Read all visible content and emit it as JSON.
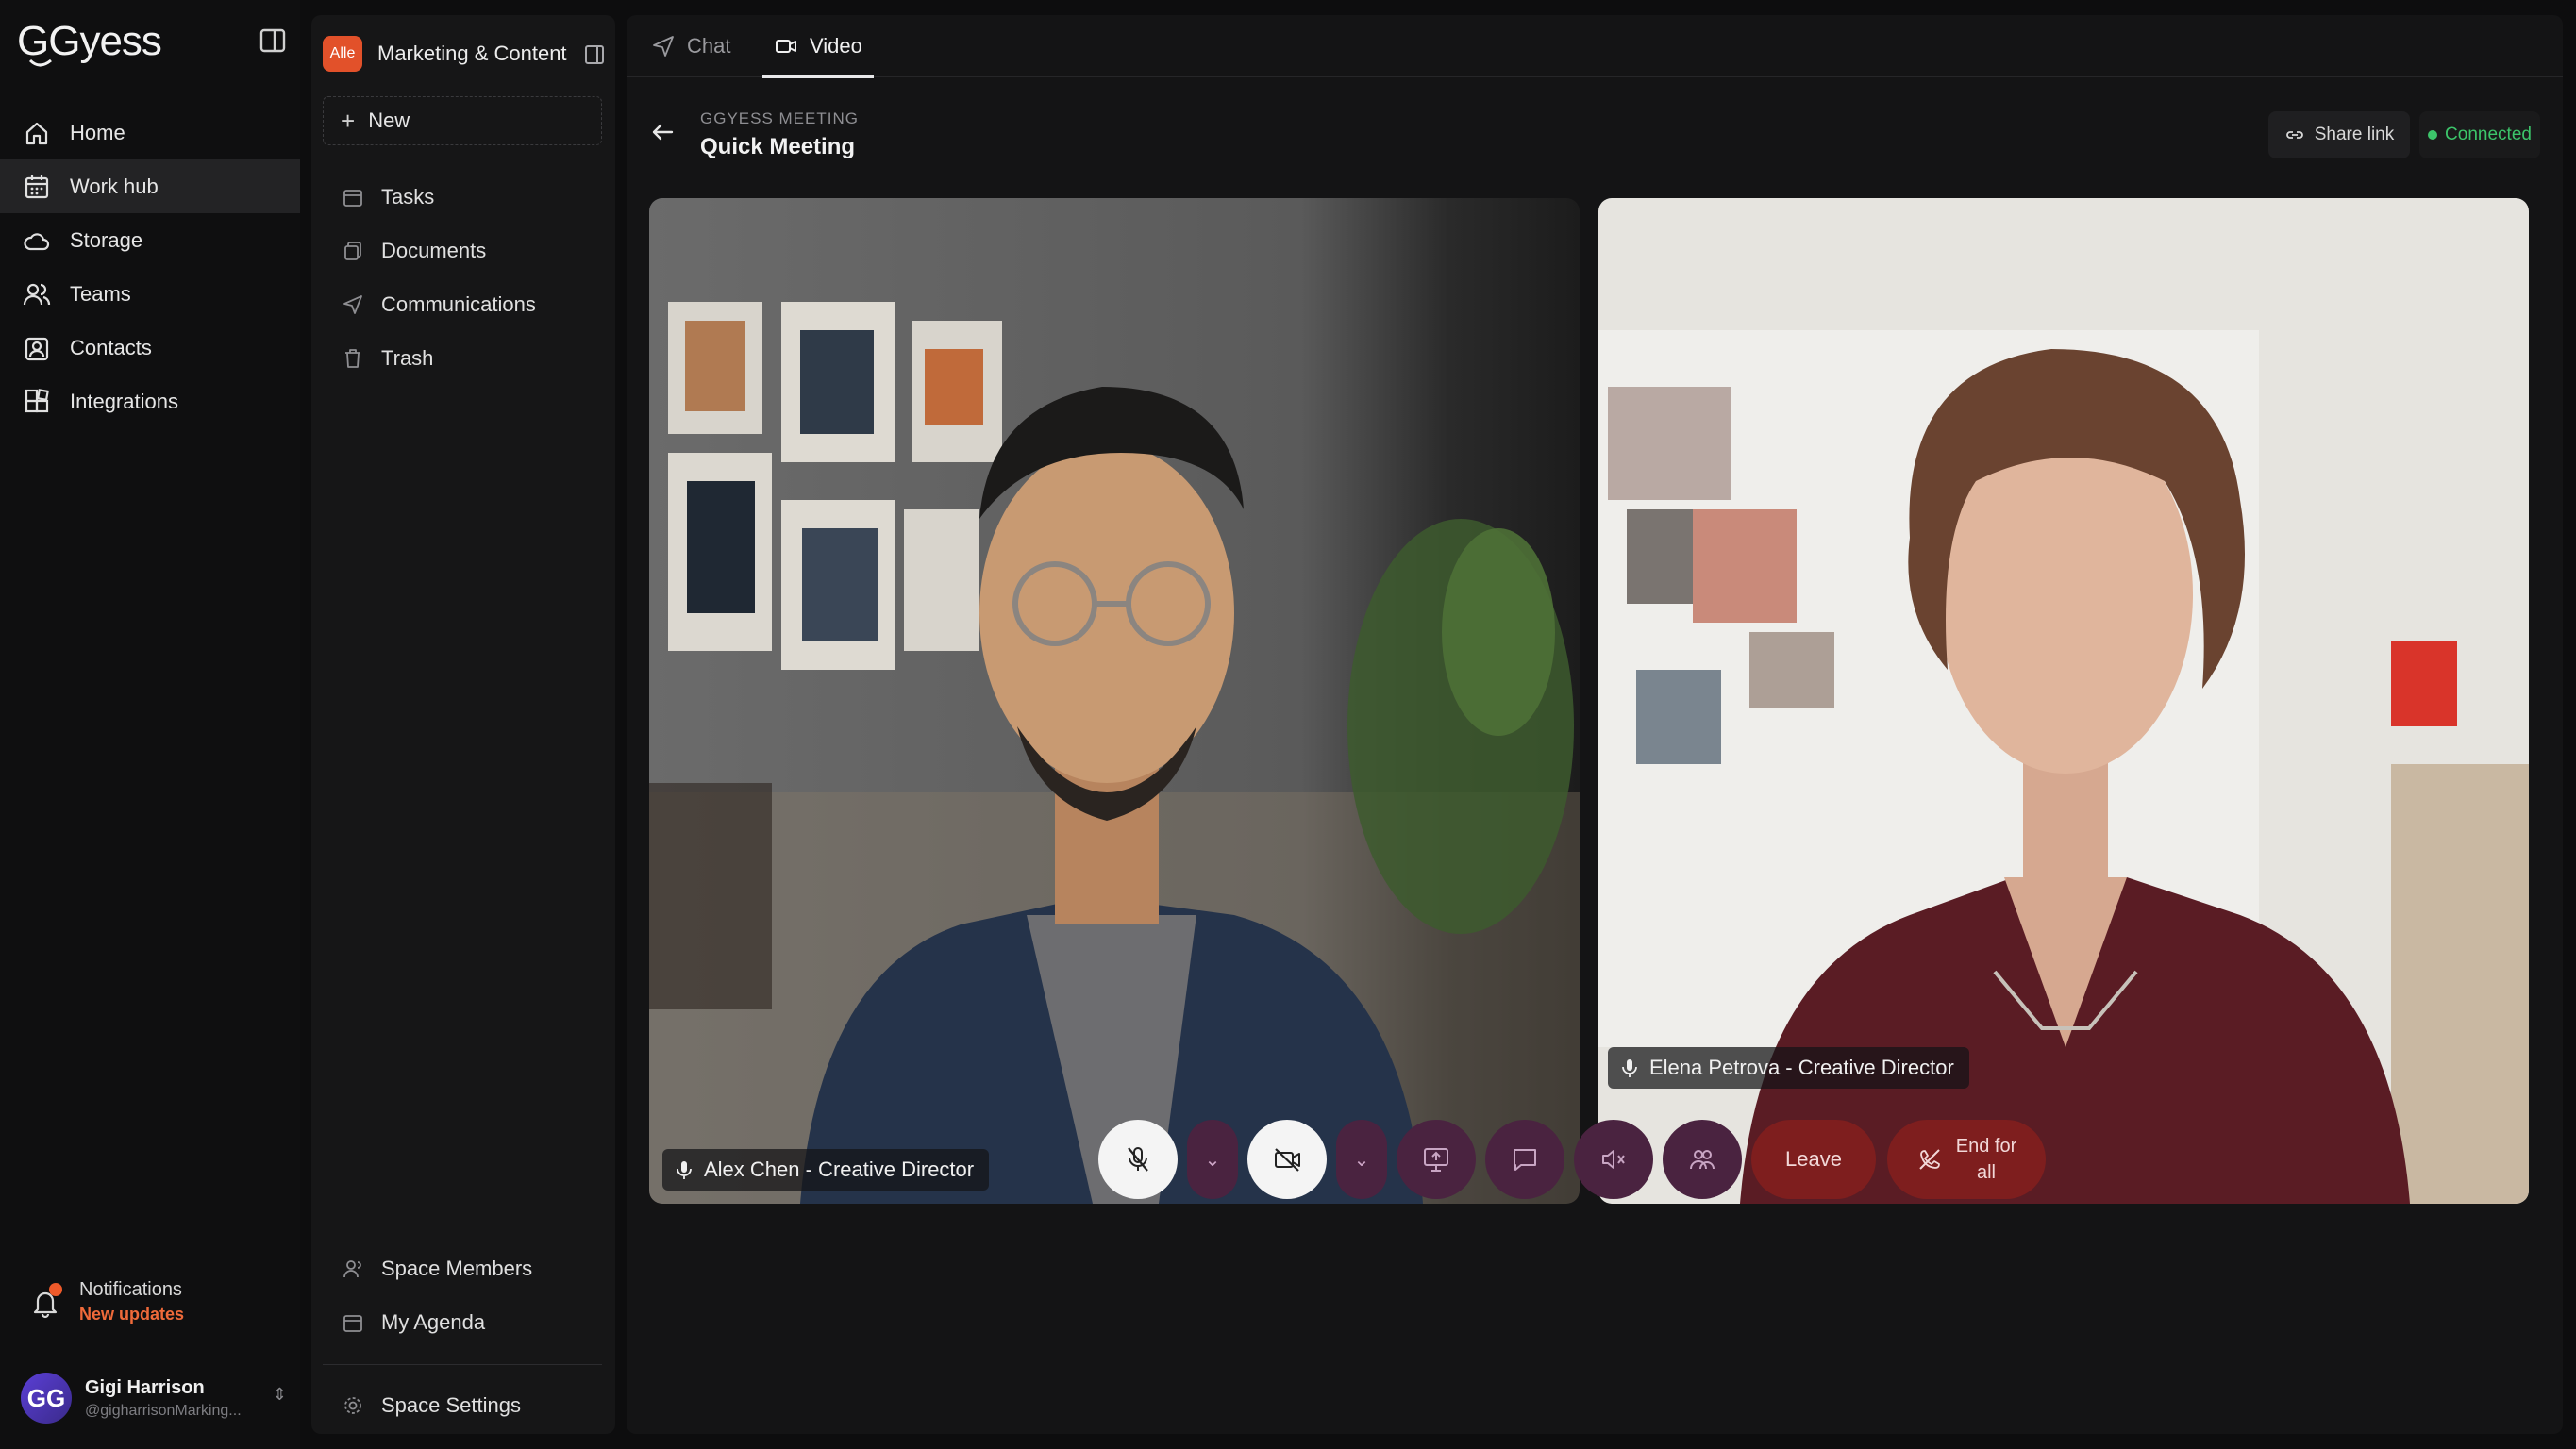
{
  "brand": {
    "logo": "GGyess"
  },
  "nav": {
    "items": [
      {
        "label": "Home",
        "icon": "home-icon"
      },
      {
        "label": "Work hub",
        "icon": "calendar-icon",
        "active": true
      },
      {
        "label": "Storage",
        "icon": "cloud-icon"
      },
      {
        "label": "Teams",
        "icon": "users-icon"
      },
      {
        "label": "Contacts",
        "icon": "contact-card-icon"
      },
      {
        "label": "Integrations",
        "icon": "puzzle-icon"
      }
    ]
  },
  "notifications": {
    "title": "Notifications",
    "subtitle": "New updates",
    "accent": "#ef6a3a"
  },
  "user": {
    "name": "Gigi Harrison",
    "handle": "@gigharrisonMarking...",
    "initials": "GG"
  },
  "space": {
    "badge": "Alle",
    "title": "Marketing & Content",
    "new_label": "New",
    "items": [
      {
        "label": "Tasks",
        "icon": "calendar-icon"
      },
      {
        "label": "Documents",
        "icon": "documents-icon"
      },
      {
        "label": "Communications",
        "icon": "send-icon"
      },
      {
        "label": "Trash",
        "icon": "trash-icon"
      }
    ],
    "bottom_items": [
      {
        "label": "Space Members",
        "icon": "user-icon"
      },
      {
        "label": "My Agenda",
        "icon": "calendar-icon"
      }
    ],
    "settings_label": "Space Settings"
  },
  "tabs": [
    {
      "label": "Chat",
      "icon": "send-icon",
      "active": false
    },
    {
      "label": "Video",
      "icon": "video-icon",
      "active": true
    }
  ],
  "meeting": {
    "label": "GGYESS MEETING",
    "title": "Quick Meeting",
    "share_label": "Share link",
    "status": "Connected",
    "status_color": "#3cc46a"
  },
  "participants": [
    {
      "name": "Alex Chen - Creative Director"
    },
    {
      "name": "Elena Petrova - Creative Director"
    }
  ],
  "controls": {
    "leave_label": "Leave",
    "end_label_1": "End for",
    "end_label_2": "all",
    "danger_color": "#7e1e1e",
    "purple_color": "#4a2340"
  }
}
